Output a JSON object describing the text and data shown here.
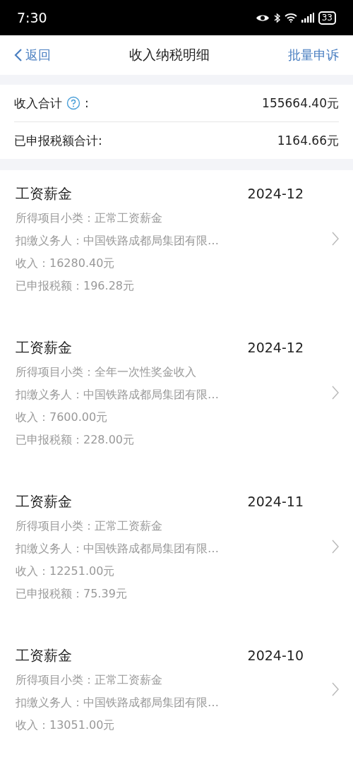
{
  "status_bar": {
    "time": "7:30",
    "battery": "33"
  },
  "nav": {
    "back": "返回",
    "title": "收入纳税明细",
    "action": "批量申诉"
  },
  "summary": [
    {
      "kind": "help",
      "label": "收入合计",
      "suffix": ":",
      "value": "155664.40元"
    },
    {
      "kind": "plain",
      "label": "已申报税额合计:",
      "value": "1164.66元"
    }
  ],
  "items": [
    {
      "title": "工资薪金",
      "date": "2024-12",
      "lines": [
        "所得项目小类：正常工资薪金",
        "扣缴义务人：中国铁路成都局集团有限…",
        "收入：16280.40元",
        "已申报税额：196.28元"
      ]
    },
    {
      "title": "工资薪金",
      "date": "2024-12",
      "lines": [
        "所得项目小类：全年一次性奖金收入",
        "扣缴义务人：中国铁路成都局集团有限…",
        "收入：7600.00元",
        "已申报税额：228.00元"
      ]
    },
    {
      "title": "工资薪金",
      "date": "2024-11",
      "lines": [
        "所得项目小类：正常工资薪金",
        "扣缴义务人：中国铁路成都局集团有限…",
        "收入：12251.00元",
        "已申报税额：75.39元"
      ]
    },
    {
      "title": "工资薪金",
      "date": "2024-10",
      "lines": [
        "所得项目小类：正常工资薪金",
        "扣缴义务人：中国铁路成都局集团有限…",
        "收入：13051.00元"
      ]
    }
  ]
}
